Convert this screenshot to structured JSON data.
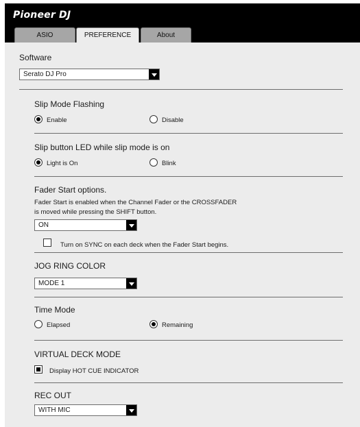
{
  "header": {
    "brand": "Pioneer DJ"
  },
  "tabs": [
    {
      "label": "ASIO",
      "active": false
    },
    {
      "label": "PREFERENCE",
      "active": true
    },
    {
      "label": "About",
      "active": false
    }
  ],
  "software": {
    "label": "Software",
    "selected": "Serato DJ Pro"
  },
  "slip_mode_flashing": {
    "title": "Slip Mode Flashing",
    "option1": "Enable",
    "option2": "Disable",
    "selected": "Enable"
  },
  "slip_button_led": {
    "title": "Slip button LED while slip mode is on",
    "option1": "Light is On",
    "option2": "Blink",
    "selected": "Light is On"
  },
  "fader_start": {
    "title": "Fader Start options.",
    "desc_line1": "Fader Start is enabled when the Channel Fader or the CROSSFADER",
    "desc_line2": "is moved while pressing the SHIFT button.",
    "selected": "ON",
    "sync_label": "Turn on SYNC on each deck when the Fader Start begins.",
    "sync_checked": false
  },
  "jog_ring_color": {
    "title": "JOG RING COLOR",
    "selected": "MODE 1"
  },
  "time_mode": {
    "title": "Time Mode",
    "option1": "Elapsed",
    "option2": "Remaining",
    "selected": "Remaining"
  },
  "virtual_deck_mode": {
    "title": "VIRTUAL DECK MODE",
    "hot_cue_label": "Display HOT CUE INDICATOR",
    "hot_cue_checked": true
  },
  "rec_out": {
    "title": "REC OUT",
    "selected": "WITH MIC"
  }
}
